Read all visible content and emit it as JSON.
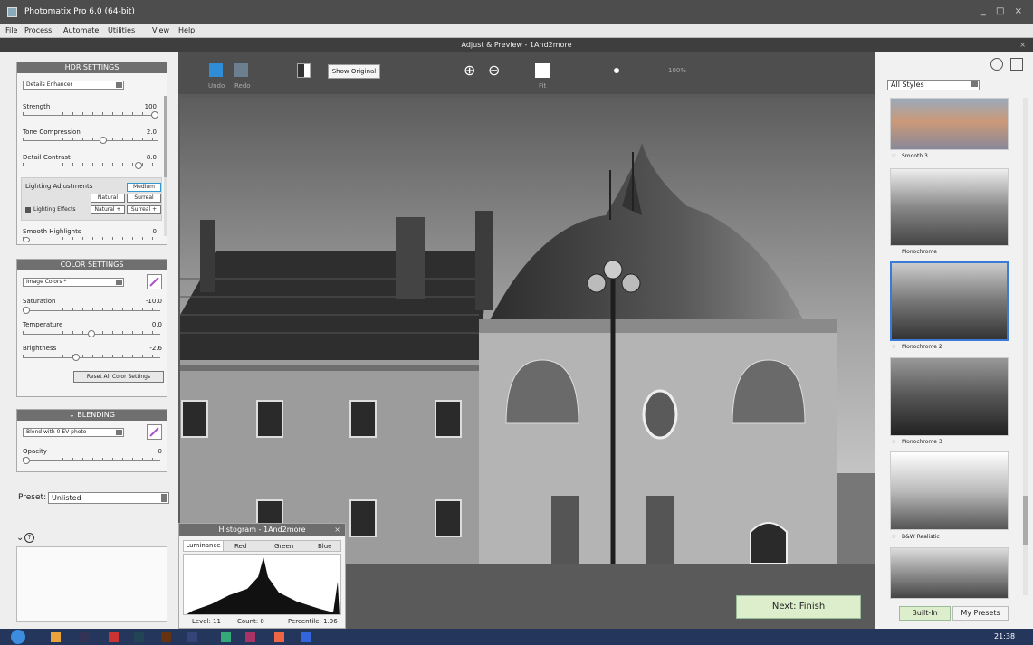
{
  "window": {
    "title": "Photomatix Pro 6.0 (64-bit)",
    "controls": "_ □ ×"
  },
  "menu": [
    "File",
    "Process",
    "Automate",
    "Utilities",
    "View",
    "Help"
  ],
  "subtitle": "Adjust & Preview - 1And2more",
  "hdr": {
    "heading": "HDR SETTINGS",
    "method": "Details Enhancer",
    "sliders": [
      {
        "label": "Strength",
        "value": "100",
        "pos": 1.0
      },
      {
        "label": "Tone Compression",
        "value": "2.0",
        "pos": 0.6
      },
      {
        "label": "Detail Contrast",
        "value": "8.0",
        "pos": 0.87
      }
    ],
    "lighting": {
      "label": "Lighting Adjustments",
      "medium": "Medium",
      "natural": "Natural",
      "surreal": "Surreal",
      "effects": "Lighting Effects",
      "natural_plus": "Natural +",
      "surreal_plus": "Surreal +"
    },
    "smooth": {
      "label": "Smooth Highlights",
      "value": "0",
      "pos": 0
    }
  },
  "color": {
    "heading": "COLOR SETTINGS",
    "mode": "Image Colors *",
    "sliders": [
      {
        "label": "Saturation",
        "value": "-10.0",
        "pos": 0
      },
      {
        "label": "Temperature",
        "value": "0.0",
        "pos": 0.5
      },
      {
        "label": "Brightness",
        "value": "-2.6",
        "pos": 0.38
      }
    ],
    "reset": "Reset All Color Settings"
  },
  "blending": {
    "heading": "BLENDING",
    "mode": "Blend with 0 EV photo",
    "opacity_label": "Opacity",
    "opacity_value": "0",
    "pos": 0
  },
  "preset": {
    "label": "Preset:",
    "value": "Unlisted"
  },
  "toolbar": {
    "undo": "Undo",
    "redo": "Redo",
    "show_original": "Show Original",
    "fit": "Fit",
    "zoom": "100%",
    "zoom_level": 0.5
  },
  "histogram": {
    "title": "Histogram - 1And2more",
    "tabs": [
      "Luminance",
      "Red",
      "Green",
      "Blue"
    ],
    "level": "Level: 11",
    "count": "Count: 0",
    "percentile": "Percentile: 1.96"
  },
  "next": "Next: Finish",
  "styles": {
    "filter": "All Styles",
    "presets": [
      "Smooth 3",
      "Monochrome",
      "Monochrome 2",
      "Monochrome 3",
      "B&W Realistic"
    ],
    "builtin": "Built-In",
    "mypresets": "My Presets"
  },
  "taskbar": {
    "time": "21:38"
  }
}
